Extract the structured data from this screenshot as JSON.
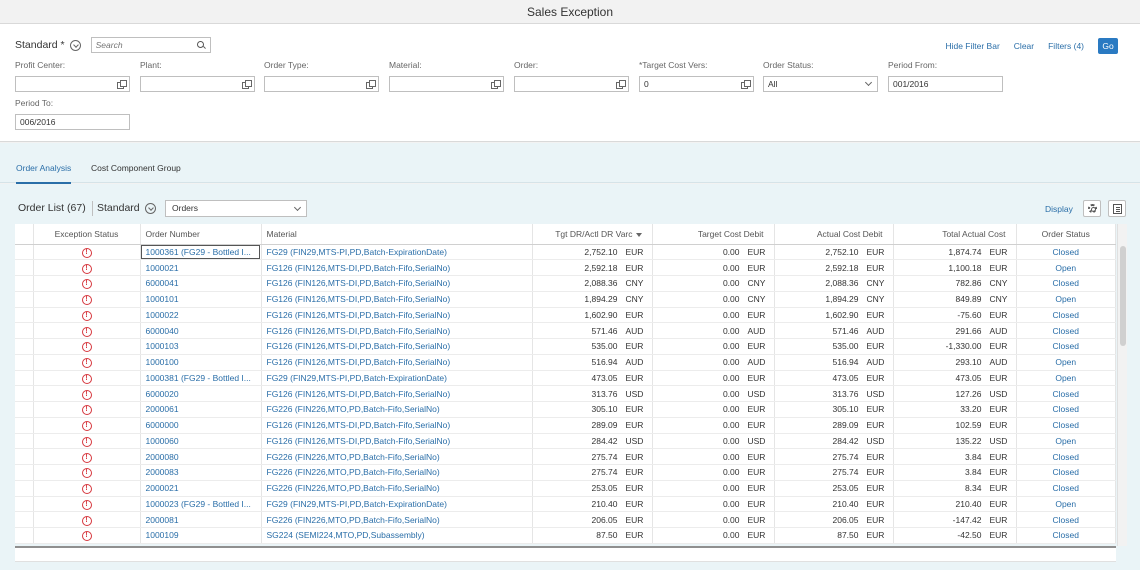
{
  "app": {
    "title": "Sales Exception"
  },
  "filterbar": {
    "variant": "Standard *",
    "search_placeholder": "Search",
    "hide_filter_bar": "Hide Filter Bar",
    "clear": "Clear",
    "filters": "Filters (4)",
    "go": "Go",
    "fields": [
      {
        "label": "Profit Center:",
        "value": ""
      },
      {
        "label": "Plant:",
        "value": ""
      },
      {
        "label": "Order Type:",
        "value": ""
      },
      {
        "label": "Material:",
        "value": ""
      },
      {
        "label": "Order:",
        "value": ""
      },
      {
        "label": "*Target Cost Vers:",
        "value": "0"
      },
      {
        "label": "Order Status:",
        "value": "All"
      },
      {
        "label": "Period From:",
        "value": "001/2016"
      },
      {
        "label": "Period To:",
        "value": "006/2016"
      }
    ]
  },
  "tabs": [
    {
      "label": "Order Analysis",
      "active": true
    },
    {
      "label": "Cost Component Group",
      "active": false
    }
  ],
  "table": {
    "title": "Order List (67)",
    "variant": "Standard",
    "view_select": "Orders",
    "display": "Display",
    "columns": [
      "Exception Status",
      "Order Number",
      "Material",
      "Tgt DR/Actl DR Varc",
      "Target Cost Debit",
      "Actual Cost Debit",
      "Total Actual Cost",
      "Order Status"
    ],
    "rows": [
      {
        "order": "1000361 (FG29 - Bottled I...",
        "material": "FG29 (FIN29,MTS-PI,PD,Batch-ExpirationDate)",
        "var_amt": "2,752.10",
        "var_cur": "EUR",
        "tgt_amt": "0.00",
        "tgt_cur": "EUR",
        "act_amt": "2,752.10",
        "act_cur": "EUR",
        "tot_amt": "1,874.74",
        "tot_cur": "EUR",
        "status": "Closed"
      },
      {
        "order": "1000021",
        "material": "FG126 (FIN126,MTS-DI,PD,Batch-Fifo,SerialNo)",
        "var_amt": "2,592.18",
        "var_cur": "EUR",
        "tgt_amt": "0.00",
        "tgt_cur": "EUR",
        "act_amt": "2,592.18",
        "act_cur": "EUR",
        "tot_amt": "1,100.18",
        "tot_cur": "EUR",
        "status": "Open"
      },
      {
        "order": "6000041",
        "material": "FG126 (FIN126,MTS-DI,PD,Batch-Fifo,SerialNo)",
        "var_amt": "2,088.36",
        "var_cur": "CNY",
        "tgt_amt": "0.00",
        "tgt_cur": "CNY",
        "act_amt": "2,088.36",
        "act_cur": "CNY",
        "tot_amt": "782.86",
        "tot_cur": "CNY",
        "status": "Closed"
      },
      {
        "order": "1000101",
        "material": "FG126 (FIN126,MTS-DI,PD,Batch-Fifo,SerialNo)",
        "var_amt": "1,894.29",
        "var_cur": "CNY",
        "tgt_amt": "0.00",
        "tgt_cur": "CNY",
        "act_amt": "1,894.29",
        "act_cur": "CNY",
        "tot_amt": "849.89",
        "tot_cur": "CNY",
        "status": "Open"
      },
      {
        "order": "1000022",
        "material": "FG126 (FIN126,MTS-DI,PD,Batch-Fifo,SerialNo)",
        "var_amt": "1,602.90",
        "var_cur": "EUR",
        "tgt_amt": "0.00",
        "tgt_cur": "EUR",
        "act_amt": "1,602.90",
        "act_cur": "EUR",
        "tot_amt": "-75.60",
        "tot_cur": "EUR",
        "status": "Closed"
      },
      {
        "order": "6000040",
        "material": "FG126 (FIN126,MTS-DI,PD,Batch-Fifo,SerialNo)",
        "var_amt": "571.46",
        "var_cur": "AUD",
        "tgt_amt": "0.00",
        "tgt_cur": "AUD",
        "act_amt": "571.46",
        "act_cur": "AUD",
        "tot_amt": "291.66",
        "tot_cur": "AUD",
        "status": "Closed"
      },
      {
        "order": "1000103",
        "material": "FG126 (FIN126,MTS-DI,PD,Batch-Fifo,SerialNo)",
        "var_amt": "535.00",
        "var_cur": "EUR",
        "tgt_amt": "0.00",
        "tgt_cur": "EUR",
        "act_amt": "535.00",
        "act_cur": "EUR",
        "tot_amt": "-1,330.00",
        "tot_cur": "EUR",
        "status": "Closed"
      },
      {
        "order": "1000100",
        "material": "FG126 (FIN126,MTS-DI,PD,Batch-Fifo,SerialNo)",
        "var_amt": "516.94",
        "var_cur": "AUD",
        "tgt_amt": "0.00",
        "tgt_cur": "AUD",
        "act_amt": "516.94",
        "act_cur": "AUD",
        "tot_amt": "293.10",
        "tot_cur": "AUD",
        "status": "Open"
      },
      {
        "order": "1000381 (FG29 - Bottled I...",
        "material": "FG29 (FIN29,MTS-PI,PD,Batch-ExpirationDate)",
        "var_amt": "473.05",
        "var_cur": "EUR",
        "tgt_amt": "0.00",
        "tgt_cur": "EUR",
        "act_amt": "473.05",
        "act_cur": "EUR",
        "tot_amt": "473.05",
        "tot_cur": "EUR",
        "status": "Open"
      },
      {
        "order": "6000020",
        "material": "FG126 (FIN126,MTS-DI,PD,Batch-Fifo,SerialNo)",
        "var_amt": "313.76",
        "var_cur": "USD",
        "tgt_amt": "0.00",
        "tgt_cur": "USD",
        "act_amt": "313.76",
        "act_cur": "USD",
        "tot_amt": "127.26",
        "tot_cur": "USD",
        "status": "Closed"
      },
      {
        "order": "2000061",
        "material": "FG226 (FIN226,MTO,PD,Batch-Fifo,SerialNo)",
        "var_amt": "305.10",
        "var_cur": "EUR",
        "tgt_amt": "0.00",
        "tgt_cur": "EUR",
        "act_amt": "305.10",
        "act_cur": "EUR",
        "tot_amt": "33.20",
        "tot_cur": "EUR",
        "status": "Closed"
      },
      {
        "order": "6000000",
        "material": "FG126 (FIN126,MTS-DI,PD,Batch-Fifo,SerialNo)",
        "var_amt": "289.09",
        "var_cur": "EUR",
        "tgt_amt": "0.00",
        "tgt_cur": "EUR",
        "act_amt": "289.09",
        "act_cur": "EUR",
        "tot_amt": "102.59",
        "tot_cur": "EUR",
        "status": "Closed"
      },
      {
        "order": "1000060",
        "material": "FG126 (FIN126,MTS-DI,PD,Batch-Fifo,SerialNo)",
        "var_amt": "284.42",
        "var_cur": "USD",
        "tgt_amt": "0.00",
        "tgt_cur": "USD",
        "act_amt": "284.42",
        "act_cur": "USD",
        "tot_amt": "135.22",
        "tot_cur": "USD",
        "status": "Open"
      },
      {
        "order": "2000080",
        "material": "FG226 (FIN226,MTO,PD,Batch-Fifo,SerialNo)",
        "var_amt": "275.74",
        "var_cur": "EUR",
        "tgt_amt": "0.00",
        "tgt_cur": "EUR",
        "act_amt": "275.74",
        "act_cur": "EUR",
        "tot_amt": "3.84",
        "tot_cur": "EUR",
        "status": "Closed"
      },
      {
        "order": "2000083",
        "material": "FG226 (FIN226,MTO,PD,Batch-Fifo,SerialNo)",
        "var_amt": "275.74",
        "var_cur": "EUR",
        "tgt_amt": "0.00",
        "tgt_cur": "EUR",
        "act_amt": "275.74",
        "act_cur": "EUR",
        "tot_amt": "3.84",
        "tot_cur": "EUR",
        "status": "Closed"
      },
      {
        "order": "2000021",
        "material": "FG226 (FIN226,MTO,PD,Batch-Fifo,SerialNo)",
        "var_amt": "253.05",
        "var_cur": "EUR",
        "tgt_amt": "0.00",
        "tgt_cur": "EUR",
        "act_amt": "253.05",
        "act_cur": "EUR",
        "tot_amt": "8.34",
        "tot_cur": "EUR",
        "status": "Closed"
      },
      {
        "order": "1000023 (FG29 - Bottled I...",
        "material": "FG29 (FIN29,MTS-PI,PD,Batch-ExpirationDate)",
        "var_amt": "210.40",
        "var_cur": "EUR",
        "tgt_amt": "0.00",
        "tgt_cur": "EUR",
        "act_amt": "210.40",
        "act_cur": "EUR",
        "tot_amt": "210.40",
        "tot_cur": "EUR",
        "status": "Open"
      },
      {
        "order": "2000081",
        "material": "FG226 (FIN226,MTO,PD,Batch-Fifo,SerialNo)",
        "var_amt": "206.05",
        "var_cur": "EUR",
        "tgt_amt": "0.00",
        "tgt_cur": "EUR",
        "act_amt": "206.05",
        "act_cur": "EUR",
        "tot_amt": "-147.42",
        "tot_cur": "EUR",
        "status": "Closed"
      },
      {
        "order": "1000109",
        "material": "SG224 (SEMI224,MTO,PD,Subassembly)",
        "var_amt": "87.50",
        "var_cur": "EUR",
        "tgt_amt": "0.00",
        "tgt_cur": "EUR",
        "act_amt": "87.50",
        "act_cur": "EUR",
        "tot_amt": "-42.50",
        "tot_cur": "EUR",
        "status": "Closed"
      }
    ]
  },
  "colors": {
    "link": "#2a6ea8",
    "error": "#d6373e",
    "go_button": "#2a7ac2",
    "tab_background": "#eaf4f7"
  }
}
